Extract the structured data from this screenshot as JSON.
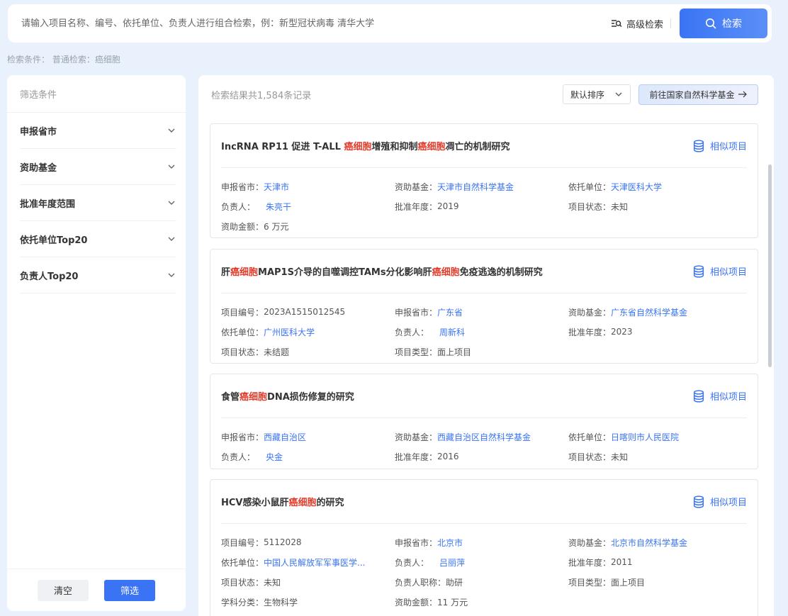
{
  "search": {
    "placeholder": "请输入项目名称、编号、依托单位、负责人进行组合检索，例：新型冠状病毒 清华大学",
    "advanced_label": "高级检索",
    "button_label": "检索"
  },
  "condition": {
    "text": "检索条件：  普通检索：癌细胞"
  },
  "filter": {
    "title": "筛选条件",
    "facets": [
      "申报省市",
      "资助基金",
      "批准年度范围",
      "依托单位Top20",
      "负责人Top20"
    ],
    "clear_label": "清空",
    "apply_label": "筛选"
  },
  "results": {
    "count_text": "检索结果共1,584条记录",
    "sort_label": "默认排序",
    "goto_label": "前往国家自然科学基金",
    "similar_label": "相似项目",
    "cards": [
      {
        "title_parts": [
          "IncRNA RP11 促进 T-ALL ",
          "癌细胞",
          "增殖和抑制",
          "癌细胞",
          "凋亡的机制研究"
        ],
        "fields": [
          {
            "k": "申报省市：",
            "v": "天津市",
            "link": true
          },
          {
            "k": "资助基金：",
            "v": "天津市自然科学基金",
            "link": true
          },
          {
            "k": "依托单位：",
            "v": "天津医科大学",
            "link": true
          },
          {
            "k": "负责人：",
            "v": "朱亮干",
            "link": true,
            "pad": true
          },
          {
            "k": "批准年度：",
            "v": "2019",
            "link": false
          },
          {
            "k": "项目状态：",
            "v": "未知",
            "link": false
          },
          {
            "k": "资助金额：",
            "v": "6 万元",
            "link": false
          }
        ]
      },
      {
        "title_parts": [
          "肝",
          "癌细胞",
          "MAP1S介导的自噬调控TAMs分化影响肝",
          "癌细胞",
          "免疫逃逸的机制研究"
        ],
        "fields": [
          {
            "k": "项目编号：",
            "v": "2023A1515012545",
            "link": false
          },
          {
            "k": "申报省市：",
            "v": "广东省",
            "link": true
          },
          {
            "k": "资助基金：",
            "v": "广东省自然科学基金",
            "link": true
          },
          {
            "k": "依托单位：",
            "v": "广州医科大学",
            "link": true
          },
          {
            "k": "负责人：",
            "v": "周新科",
            "link": true,
            "pad": true
          },
          {
            "k": "批准年度：",
            "v": "2023",
            "link": false
          },
          {
            "k": "项目状态：",
            "v": "未结题",
            "link": false
          },
          {
            "k": "项目类型：",
            "v": "面上项目",
            "link": false
          }
        ]
      },
      {
        "title_parts": [
          "食管",
          "癌细胞",
          "DNA损伤修复的研究"
        ],
        "fields": [
          {
            "k": "申报省市：",
            "v": "西藏自治区",
            "link": true
          },
          {
            "k": "资助基金：",
            "v": "西藏自治区自然科学基金",
            "link": true
          },
          {
            "k": "依托单位：",
            "v": "日喀则市人民医院",
            "link": true
          },
          {
            "k": "负责人：",
            "v": "央金",
            "link": true,
            "pad": true
          },
          {
            "k": "批准年度：",
            "v": "2016",
            "link": false
          },
          {
            "k": "项目状态：",
            "v": "未知",
            "link": false
          }
        ]
      },
      {
        "title_parts": [
          "HCV感染小鼠肝",
          "癌细胞",
          "的研究"
        ],
        "fields": [
          {
            "k": "项目编号：",
            "v": "5112028",
            "link": false
          },
          {
            "k": "申报省市：",
            "v": "北京市",
            "link": true
          },
          {
            "k": "资助基金：",
            "v": "北京市自然科学基金",
            "link": true
          },
          {
            "k": "依托单位：",
            "v": "中国人民解放军军事医学...",
            "link": true
          },
          {
            "k": "负责人：",
            "v": "吕丽萍",
            "link": true,
            "pad": true
          },
          {
            "k": "批准年度：",
            "v": "2011",
            "link": false
          },
          {
            "k": "项目状态：",
            "v": "未知",
            "link": false
          },
          {
            "k": "负责人职称：",
            "v": "助研",
            "link": false
          },
          {
            "k": "项目类型：",
            "v": "面上项目",
            "link": false
          },
          {
            "k": "学科分类：",
            "v": "生物科学",
            "link": false
          },
          {
            "k": "资助金额：",
            "v": "11 万元",
            "link": false
          }
        ]
      }
    ]
  }
}
